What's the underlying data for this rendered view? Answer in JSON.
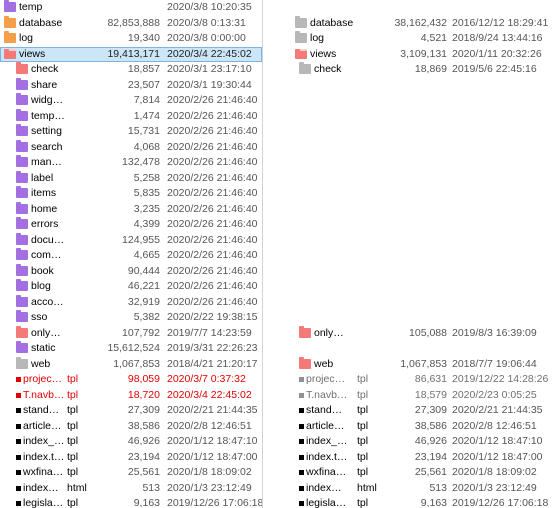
{
  "colors": {
    "folder_purple": "#a46fe0",
    "folder_salmon": "#f47a7a",
    "folder_gray": "#b8b8b8",
    "folder_orange": "#f4a04a",
    "selection": "#cde6f7",
    "changed_text": "#e00000",
    "orphan_text": "#707070"
  },
  "left": {
    "rows": [
      {
        "name": "temp",
        "ext": "",
        "size": "",
        "date": "2020/3/8 10:20:35",
        "kind": "folder",
        "color": "#a46fe0",
        "style": "normal",
        "indent": 0,
        "open": false,
        "selected": false
      },
      {
        "name": "database",
        "ext": "",
        "size": "82,853,888",
        "date": "2020/3/8 0:13:31",
        "kind": "folder",
        "color": "#f4a04a",
        "style": "normal",
        "indent": 0,
        "open": false,
        "selected": false
      },
      {
        "name": "log",
        "ext": "",
        "size": "19,340",
        "date": "2020/3/8 0:00:00",
        "kind": "folder",
        "color": "#f4a04a",
        "style": "normal",
        "indent": 0,
        "open": false,
        "selected": false
      },
      {
        "name": "views",
        "ext": "",
        "size": "19,413,171",
        "date": "2020/3/4 22:45:02",
        "kind": "folder",
        "color": "#f47a7a",
        "style": "normal",
        "indent": 0,
        "open": true,
        "selected": true
      },
      {
        "name": "check",
        "ext": "",
        "size": "18,857",
        "date": "2020/3/1 23:17:10",
        "kind": "folder",
        "color": "#f47a7a",
        "style": "normal",
        "indent": 1,
        "open": false,
        "selected": false
      },
      {
        "name": "share",
        "ext": "",
        "size": "23,507",
        "date": "2020/3/1 19:30:44",
        "kind": "folder",
        "color": "#a46fe0",
        "style": "normal",
        "indent": 1,
        "open": false,
        "selected": false
      },
      {
        "name": "widg…",
        "ext": "",
        "size": "7,814",
        "date": "2020/2/26 21:46:40",
        "kind": "folder",
        "color": "#a46fe0",
        "style": "normal",
        "indent": 1,
        "open": false,
        "selected": false
      },
      {
        "name": "temp…",
        "ext": "",
        "size": "1,474",
        "date": "2020/2/26 21:46:40",
        "kind": "folder",
        "color": "#a46fe0",
        "style": "normal",
        "indent": 1,
        "open": false,
        "selected": false
      },
      {
        "name": "setting",
        "ext": "",
        "size": "15,731",
        "date": "2020/2/26 21:46:40",
        "kind": "folder",
        "color": "#a46fe0",
        "style": "normal",
        "indent": 1,
        "open": false,
        "selected": false
      },
      {
        "name": "search",
        "ext": "",
        "size": "4,068",
        "date": "2020/2/26 21:46:40",
        "kind": "folder",
        "color": "#a46fe0",
        "style": "normal",
        "indent": 1,
        "open": false,
        "selected": false
      },
      {
        "name": "man…",
        "ext": "",
        "size": "132,478",
        "date": "2020/2/26 21:46:40",
        "kind": "folder",
        "color": "#a46fe0",
        "style": "normal",
        "indent": 1,
        "open": false,
        "selected": false
      },
      {
        "name": "label",
        "ext": "",
        "size": "5,258",
        "date": "2020/2/26 21:46:40",
        "kind": "folder",
        "color": "#a46fe0",
        "style": "normal",
        "indent": 1,
        "open": false,
        "selected": false
      },
      {
        "name": "items",
        "ext": "",
        "size": "5,835",
        "date": "2020/2/26 21:46:40",
        "kind": "folder",
        "color": "#a46fe0",
        "style": "normal",
        "indent": 1,
        "open": false,
        "selected": false
      },
      {
        "name": "home",
        "ext": "",
        "size": "3,235",
        "date": "2020/2/26 21:46:40",
        "kind": "folder",
        "color": "#a46fe0",
        "style": "normal",
        "indent": 1,
        "open": false,
        "selected": false
      },
      {
        "name": "errors",
        "ext": "",
        "size": "4,399",
        "date": "2020/2/26 21:46:40",
        "kind": "folder",
        "color": "#a46fe0",
        "style": "normal",
        "indent": 1,
        "open": false,
        "selected": false
      },
      {
        "name": "docu…",
        "ext": "",
        "size": "124,955",
        "date": "2020/2/26 21:46:40",
        "kind": "folder",
        "color": "#a46fe0",
        "style": "normal",
        "indent": 1,
        "open": false,
        "selected": false
      },
      {
        "name": "com…",
        "ext": "",
        "size": "4,665",
        "date": "2020/2/26 21:46:40",
        "kind": "folder",
        "color": "#a46fe0",
        "style": "normal",
        "indent": 1,
        "open": false,
        "selected": false
      },
      {
        "name": "book",
        "ext": "",
        "size": "90,444",
        "date": "2020/2/26 21:46:40",
        "kind": "folder",
        "color": "#a46fe0",
        "style": "normal",
        "indent": 1,
        "open": false,
        "selected": false
      },
      {
        "name": "blog",
        "ext": "",
        "size": "46,221",
        "date": "2020/2/26 21:46:40",
        "kind": "folder",
        "color": "#a46fe0",
        "style": "normal",
        "indent": 1,
        "open": false,
        "selected": false
      },
      {
        "name": "acco…",
        "ext": "",
        "size": "32,919",
        "date": "2020/2/26 21:46:40",
        "kind": "folder",
        "color": "#a46fe0",
        "style": "normal",
        "indent": 1,
        "open": false,
        "selected": false
      },
      {
        "name": "sso",
        "ext": "",
        "size": "5,382",
        "date": "2020/2/22 19:38:15",
        "kind": "folder",
        "color": "#a46fe0",
        "style": "normal",
        "indent": 1,
        "open": false,
        "selected": false
      },
      {
        "name": "only…",
        "ext": "",
        "size": "107,792",
        "date": "2019/7/7 14:23:59",
        "kind": "folder",
        "color": "#f47a7a",
        "style": "normal",
        "indent": 1,
        "open": false,
        "selected": false
      },
      {
        "name": "static",
        "ext": "",
        "size": "15,612,524",
        "date": "2019/3/31 22:26:23",
        "kind": "folder",
        "color": "#a46fe0",
        "style": "normal",
        "indent": 1,
        "open": false,
        "selected": false
      },
      {
        "name": "web",
        "ext": "",
        "size": "1,067,853",
        "date": "2018/4/21 21:20:17",
        "kind": "folder",
        "color": "#b8b8b8",
        "style": "normal",
        "indent": 1,
        "open": false,
        "selected": false
      },
      {
        "name": "projec…",
        "ext": "tpl",
        "size": "98,059",
        "date": "2020/3/7 0:37:32",
        "kind": "file",
        "color": "#e00000",
        "style": "red",
        "indent": 1,
        "open": false,
        "selected": false
      },
      {
        "name": "T.navb…",
        "ext": "tpl",
        "size": "18,720",
        "date": "2020/3/4 22:45:02",
        "kind": "file",
        "color": "#e00000",
        "style": "red",
        "indent": 1,
        "open": false,
        "selected": false
      },
      {
        "name": "stand…",
        "ext": "tpl",
        "size": "27,309",
        "date": "2020/2/21 21:44:35",
        "kind": "file",
        "color": "#000000",
        "style": "normal",
        "indent": 1,
        "open": false,
        "selected": false
      },
      {
        "name": "article…",
        "ext": "tpl",
        "size": "38,586",
        "date": "2020/2/8 12:46:51",
        "kind": "file",
        "color": "#000000",
        "style": "normal",
        "indent": 1,
        "open": false,
        "selected": false
      },
      {
        "name": "index_…",
        "ext": "tpl",
        "size": "46,926",
        "date": "2020/1/12 18:47:10",
        "kind": "file",
        "color": "#000000",
        "style": "normal",
        "indent": 1,
        "open": false,
        "selected": false
      },
      {
        "name": "index.t…",
        "ext": "tpl",
        "size": "23,194",
        "date": "2020/1/12 18:47:00",
        "kind": "file",
        "color": "#000000",
        "style": "normal",
        "indent": 1,
        "open": false,
        "selected": false
      },
      {
        "name": "wxfina…",
        "ext": "tpl",
        "size": "25,561",
        "date": "2020/1/8 18:09:02",
        "kind": "file",
        "color": "#000000",
        "style": "normal",
        "indent": 1,
        "open": false,
        "selected": false
      },
      {
        "name": "index…",
        "ext": "html",
        "size": "513",
        "date": "2020/1/3 23:12:49",
        "kind": "file",
        "color": "#000000",
        "style": "normal",
        "indent": 1,
        "open": false,
        "selected": false
      },
      {
        "name": "legisla…",
        "ext": "tpl",
        "size": "9,163",
        "date": "2019/12/26 17:06:18",
        "kind": "file",
        "color": "#000000",
        "style": "normal",
        "indent": 1,
        "open": false,
        "selected": false
      }
    ]
  },
  "right": {
    "rows": [
      {
        "name": "",
        "ext": "",
        "size": "",
        "date": "",
        "kind": "blank",
        "color": "",
        "style": "normal",
        "indent": 0,
        "open": false,
        "selected": false
      },
      {
        "name": "database",
        "ext": "",
        "size": "38,162,432",
        "date": "2016/12/12 18:29:41",
        "kind": "folder",
        "color": "#b8b8b8",
        "style": "normal",
        "indent": 0,
        "open": false,
        "selected": false
      },
      {
        "name": "log",
        "ext": "",
        "size": "4,521",
        "date": "2018/9/24 13:44:16",
        "kind": "folder",
        "color": "#b8b8b8",
        "style": "normal",
        "indent": 0,
        "open": false,
        "selected": false
      },
      {
        "name": "views",
        "ext": "",
        "size": "3,109,131",
        "date": "2020/1/11 20:32:26",
        "kind": "folder",
        "color": "#f47a7a",
        "style": "normal",
        "indent": 0,
        "open": true,
        "selected": false
      },
      {
        "name": "check",
        "ext": "",
        "size": "18,869",
        "date": "2019/5/6 22:45:16",
        "kind": "folder",
        "color": "#b8b8b8",
        "style": "normal",
        "indent": 1,
        "open": false,
        "selected": false
      },
      {
        "name": "",
        "ext": "",
        "size": "",
        "date": "",
        "kind": "blank",
        "color": "",
        "style": "normal",
        "indent": 0,
        "open": false,
        "selected": false
      },
      {
        "name": "",
        "ext": "",
        "size": "",
        "date": "",
        "kind": "blank",
        "color": "",
        "style": "normal",
        "indent": 0,
        "open": false,
        "selected": false
      },
      {
        "name": "",
        "ext": "",
        "size": "",
        "date": "",
        "kind": "blank",
        "color": "",
        "style": "normal",
        "indent": 0,
        "open": false,
        "selected": false
      },
      {
        "name": "",
        "ext": "",
        "size": "",
        "date": "",
        "kind": "blank",
        "color": "",
        "style": "normal",
        "indent": 0,
        "open": false,
        "selected": false
      },
      {
        "name": "",
        "ext": "",
        "size": "",
        "date": "",
        "kind": "blank",
        "color": "",
        "style": "normal",
        "indent": 0,
        "open": false,
        "selected": false
      },
      {
        "name": "",
        "ext": "",
        "size": "",
        "date": "",
        "kind": "blank",
        "color": "",
        "style": "normal",
        "indent": 0,
        "open": false,
        "selected": false
      },
      {
        "name": "",
        "ext": "",
        "size": "",
        "date": "",
        "kind": "blank",
        "color": "",
        "style": "normal",
        "indent": 0,
        "open": false,
        "selected": false
      },
      {
        "name": "",
        "ext": "",
        "size": "",
        "date": "",
        "kind": "blank",
        "color": "",
        "style": "normal",
        "indent": 0,
        "open": false,
        "selected": false
      },
      {
        "name": "",
        "ext": "",
        "size": "",
        "date": "",
        "kind": "blank",
        "color": "",
        "style": "normal",
        "indent": 0,
        "open": false,
        "selected": false
      },
      {
        "name": "",
        "ext": "",
        "size": "",
        "date": "",
        "kind": "blank",
        "color": "",
        "style": "normal",
        "indent": 0,
        "open": false,
        "selected": false
      },
      {
        "name": "",
        "ext": "",
        "size": "",
        "date": "",
        "kind": "blank",
        "color": "",
        "style": "normal",
        "indent": 0,
        "open": false,
        "selected": false
      },
      {
        "name": "",
        "ext": "",
        "size": "",
        "date": "",
        "kind": "blank",
        "color": "",
        "style": "normal",
        "indent": 0,
        "open": false,
        "selected": false
      },
      {
        "name": "",
        "ext": "",
        "size": "",
        "date": "",
        "kind": "blank",
        "color": "",
        "style": "normal",
        "indent": 0,
        "open": false,
        "selected": false
      },
      {
        "name": "",
        "ext": "",
        "size": "",
        "date": "",
        "kind": "blank",
        "color": "",
        "style": "normal",
        "indent": 0,
        "open": false,
        "selected": false
      },
      {
        "name": "",
        "ext": "",
        "size": "",
        "date": "",
        "kind": "blank",
        "color": "",
        "style": "normal",
        "indent": 0,
        "open": false,
        "selected": false
      },
      {
        "name": "",
        "ext": "",
        "size": "",
        "date": "",
        "kind": "blank",
        "color": "",
        "style": "normal",
        "indent": 0,
        "open": false,
        "selected": false
      },
      {
        "name": "only…",
        "ext": "",
        "size": "105,088",
        "date": "2019/8/3 16:39:09",
        "kind": "folder",
        "color": "#f47a7a",
        "style": "normal",
        "indent": 1,
        "open": false,
        "selected": false
      },
      {
        "name": "",
        "ext": "",
        "size": "",
        "date": "",
        "kind": "blank",
        "color": "",
        "style": "normal",
        "indent": 0,
        "open": false,
        "selected": false
      },
      {
        "name": "web",
        "ext": "",
        "size": "1,067,853",
        "date": "2018/7/7 19:06:44",
        "kind": "folder",
        "color": "#f47a7a",
        "style": "normal",
        "indent": 1,
        "open": false,
        "selected": false
      },
      {
        "name": "projec…",
        "ext": "tpl",
        "size": "86,631",
        "date": "2019/12/22 14:28:26",
        "kind": "file",
        "color": "#909090",
        "style": "gray",
        "indent": 1,
        "open": false,
        "selected": false
      },
      {
        "name": "T.navb…",
        "ext": "tpl",
        "size": "18,579",
        "date": "2020/2/23 0:05:25",
        "kind": "file",
        "color": "#909090",
        "style": "gray",
        "indent": 1,
        "open": false,
        "selected": false
      },
      {
        "name": "stand…",
        "ext": "tpl",
        "size": "27,309",
        "date": "2020/2/21 21:44:35",
        "kind": "file",
        "color": "#000000",
        "style": "normal",
        "indent": 1,
        "open": false,
        "selected": false
      },
      {
        "name": "article…",
        "ext": "tpl",
        "size": "38,586",
        "date": "2020/2/8 12:46:51",
        "kind": "file",
        "color": "#000000",
        "style": "normal",
        "indent": 1,
        "open": false,
        "selected": false
      },
      {
        "name": "index_…",
        "ext": "tpl",
        "size": "46,926",
        "date": "2020/1/12 18:47:10",
        "kind": "file",
        "color": "#000000",
        "style": "normal",
        "indent": 1,
        "open": false,
        "selected": false
      },
      {
        "name": "index.t…",
        "ext": "tpl",
        "size": "23,194",
        "date": "2020/1/12 18:47:00",
        "kind": "file",
        "color": "#000000",
        "style": "normal",
        "indent": 1,
        "open": false,
        "selected": false
      },
      {
        "name": "wxfina…",
        "ext": "tpl",
        "size": "25,561",
        "date": "2020/1/8 18:09:02",
        "kind": "file",
        "color": "#000000",
        "style": "normal",
        "indent": 1,
        "open": false,
        "selected": false
      },
      {
        "name": "index…",
        "ext": "html",
        "size": "513",
        "date": "2020/1/3 23:12:49",
        "kind": "file",
        "color": "#000000",
        "style": "normal",
        "indent": 1,
        "open": false,
        "selected": false
      },
      {
        "name": "legisla…",
        "ext": "tpl",
        "size": "9,163",
        "date": "2019/12/26 17:06:18",
        "kind": "file",
        "color": "#000000",
        "style": "normal",
        "indent": 1,
        "open": false,
        "selected": false
      }
    ]
  }
}
